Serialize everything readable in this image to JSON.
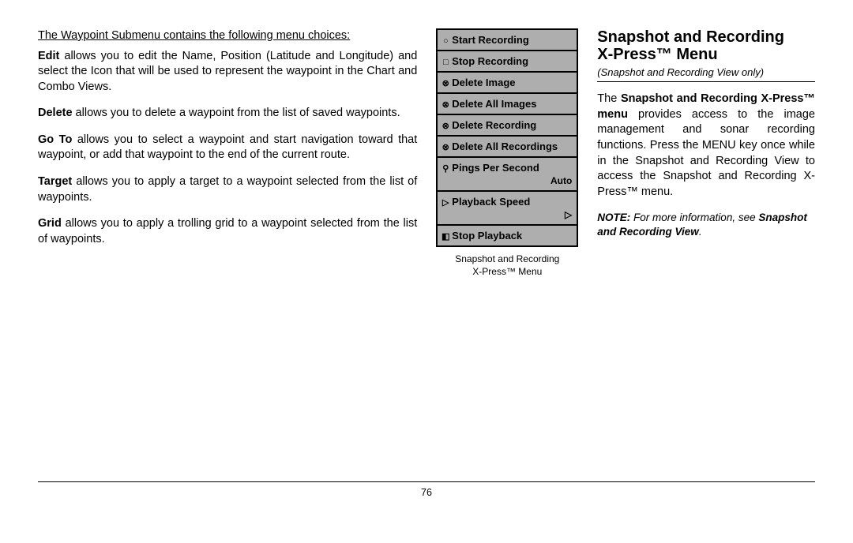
{
  "left": {
    "heading": "The Waypoint Submenu contains the following menu choices:",
    "items": [
      {
        "lead": "Edit",
        "text": " allows you to edit the Name, Position (Latitude and Longitude) and select the Icon that will be used to represent the waypoint in the Chart and Combo Views."
      },
      {
        "lead": "Delete",
        "text": " allows you to delete a waypoint from the list of saved waypoints."
      },
      {
        "lead": "Go To",
        "text": " allows you to select a waypoint and start navigation toward that waypoint, or add that waypoint to the end of the current route."
      },
      {
        "lead": "Target",
        "text": " allows you to apply a target to a waypoint selected from the list of waypoints."
      },
      {
        "lead": "Grid",
        "text": " allows you to apply a trolling grid to a waypoint selected from the list of waypoints."
      }
    ]
  },
  "menu": {
    "items": [
      {
        "icon": "○",
        "label": "Start Recording"
      },
      {
        "icon": "□",
        "label": "Stop Recording"
      },
      {
        "icon": "⊗",
        "label": "Delete Image"
      },
      {
        "icon": "⊗",
        "label": "Delete All Images"
      },
      {
        "icon": "⊗",
        "label": "Delete Recording"
      },
      {
        "icon": "⊗",
        "label": "Delete All Recordings"
      },
      {
        "icon": "⚲",
        "label": "Pings Per Second",
        "value": "Auto"
      },
      {
        "icon": "▷",
        "label": "Playback Speed",
        "value": "▷"
      },
      {
        "icon": "◧",
        "label": "Stop Playback"
      }
    ],
    "caption_l1": "Snapshot and Recording",
    "caption_l2": "X-Press™ Menu"
  },
  "right": {
    "title_l1": "Snapshot and Recording",
    "title_l2": "X-Press™ Menu",
    "subtitle": "(Snapshot and Recording View only)",
    "body_pre": "The ",
    "body_strong": "Snapshot and Recording X-Press™ menu",
    "body_post": " provides access to the image management and sonar recording functions. Press the MENU key once while in the Snapshot and Recording View to access the Snapshot and Recording X-Press™ menu.",
    "note_lead": "NOTE:",
    "note_mid": " For more information, see ",
    "note_strong": "Snapshot and Recording View",
    "note_end": "."
  },
  "page_number": "76"
}
